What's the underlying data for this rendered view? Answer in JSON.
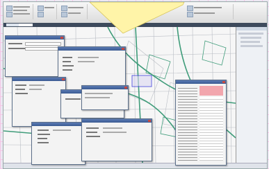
{
  "tray": {
    "shortcuts": [
      "",
      "",
      "",
      ""
    ]
  },
  "ribbon": {
    "icons": [
      "folder-icon",
      "save-icon",
      "print-icon",
      "layer-icon",
      "edit-icon",
      "measure-icon",
      "search-icon",
      "zoom-icon"
    ]
  },
  "tabs": [
    "",
    ""
  ],
  "dialogs": [
    {
      "id": "d1",
      "fields": 6
    },
    {
      "id": "d2",
      "fields": 9
    },
    {
      "id": "d3",
      "fields": 6
    },
    {
      "id": "d4",
      "fields": 4
    },
    {
      "id": "d5",
      "fields": 5
    },
    {
      "id": "d6",
      "fields": 5
    },
    {
      "id": "d7",
      "fields": 6
    },
    {
      "id": "d8",
      "fields": 32
    }
  ],
  "right_panel": {
    "tree_items": [
      "",
      "",
      "",
      ""
    ]
  },
  "colors": {
    "road": "#3f9c7a",
    "parcel": "#b9bdc4",
    "banner": "#fff4a8",
    "accent": "#3a5a92"
  }
}
